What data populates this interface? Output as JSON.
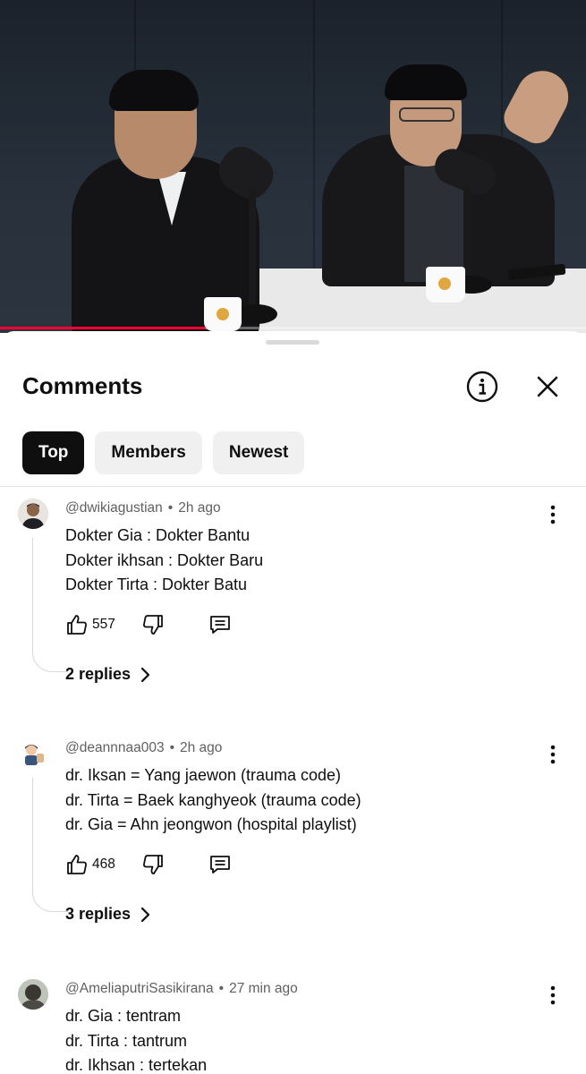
{
  "video": {
    "progress_fraction": 0.35
  },
  "sheet": {
    "title": "Comments",
    "filters": [
      {
        "label": "Top",
        "active": true
      },
      {
        "label": "Members",
        "active": false
      },
      {
        "label": "Newest",
        "active": false
      }
    ]
  },
  "comments": [
    {
      "author": "@dwikiagustian",
      "time": "2h ago",
      "lines": [
        "Dokter Gia : Dokter Bantu",
        "Dokter ikhsan : Dokter Baru",
        "Dokter Tirta : Dokter Batu"
      ],
      "likes": "557",
      "replies": "2 replies"
    },
    {
      "author": "@deannnaa003",
      "time": "2h ago",
      "lines": [
        "dr. Iksan = Yang jaewon (trauma code)",
        "dr. Tirta = Baek kanghyeok (trauma code)",
        "dr. Gia = Ahn jeongwon (hospital playlist)"
      ],
      "likes": "468",
      "replies": "3 replies"
    },
    {
      "author": "@AmeliaputriSasikirana",
      "time": "27 min ago",
      "lines": [
        "dr. Gia : tentram",
        "dr. Tirta : tantrum",
        "dr. Ikhsan : tertekan"
      ]
    }
  ],
  "separator": "•",
  "icons": {
    "info": "info-circle-icon",
    "close": "close-icon",
    "like": "thumbs-up-icon",
    "dislike": "thumbs-down-icon",
    "reply": "comment-icon",
    "more": "more-vertical-icon",
    "chevron": "chevron-right-icon"
  }
}
